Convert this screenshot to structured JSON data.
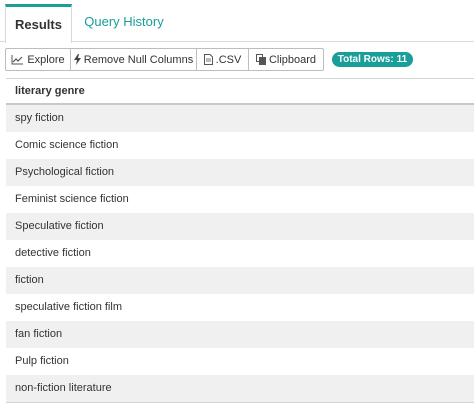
{
  "tabs": {
    "results": "Results",
    "query_history": "Query History"
  },
  "toolbar": {
    "explore": "Explore",
    "remove_null": "Remove Null Columns",
    "csv": ".CSV",
    "clipboard": "Clipboard"
  },
  "badge": {
    "label": "Total Rows:",
    "count": "11"
  },
  "table": {
    "header": "literary genre",
    "rows": [
      "spy fiction",
      "Comic science fiction",
      "Psychological fiction",
      "Feminist science fiction",
      "Speculative fiction",
      "detective fiction",
      "fiction",
      "speculative fiction film",
      "fan fiction",
      "Pulp fiction",
      "non-fiction literature"
    ]
  },
  "colors": {
    "accent": "#1a9e9a",
    "row_stripe": "#f0f0f0"
  },
  "icons": [
    "chart-line-icon",
    "bolt-icon",
    "file-icon",
    "clipboard-icon"
  ]
}
